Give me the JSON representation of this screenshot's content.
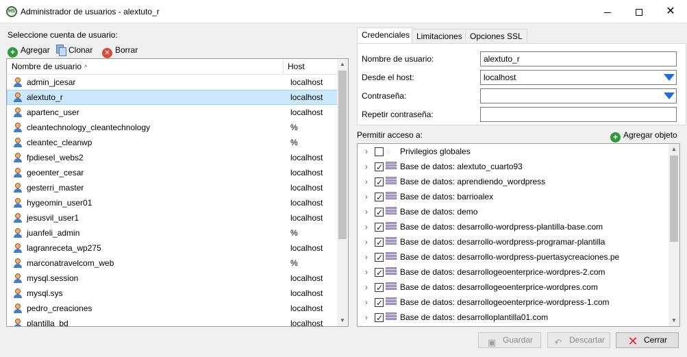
{
  "window": {
    "title": "Administrador de usuarios - alextuto_r",
    "app_icon": "HS"
  },
  "left": {
    "select_label": "Seleccione cuenta de usuario:",
    "toolbar": {
      "add": "Agregar",
      "clone": "Clonar",
      "delete": "Borrar"
    },
    "columns": {
      "name": "Nombre de usuario",
      "host": "Host"
    },
    "users": [
      {
        "name": "admin_jcesar",
        "host": "localhost"
      },
      {
        "name": "alextuto_r",
        "host": "localhost",
        "selected": true
      },
      {
        "name": "apartenc_user",
        "host": "localhost"
      },
      {
        "name": "cleantechnology_cleantechnology",
        "host": "%"
      },
      {
        "name": "cleantec_cleanwp",
        "host": "%"
      },
      {
        "name": "fpdiesel_webs2",
        "host": "localhost"
      },
      {
        "name": "geoenter_cesar",
        "host": "localhost"
      },
      {
        "name": "gesterri_master",
        "host": "localhost"
      },
      {
        "name": "hygeomin_user01",
        "host": "localhost"
      },
      {
        "name": "jesusvil_user1",
        "host": "localhost"
      },
      {
        "name": "juanfeli_admin",
        "host": "%"
      },
      {
        "name": "lagranreceta_wp275",
        "host": "localhost"
      },
      {
        "name": "marconatravelcom_web",
        "host": "%"
      },
      {
        "name": "mysql.session",
        "host": "localhost"
      },
      {
        "name": "mysql.sys",
        "host": "localhost"
      },
      {
        "name": "pedro_creaciones",
        "host": "localhost"
      },
      {
        "name": "plantilla_bd",
        "host": "localhost"
      }
    ]
  },
  "tabs": [
    {
      "label": "Credenciales",
      "active": true
    },
    {
      "label": "Limitaciones",
      "active": false
    },
    {
      "label": "Opciones SSL",
      "active": false
    }
  ],
  "credentials": {
    "username_label": "Nombre de usuario:",
    "username_value": "alextuto_r",
    "host_label": "Desde el host:",
    "host_value": "localhost",
    "password_label": "Contraseña:",
    "password_value": "",
    "repeat_label": "Repetir contraseña:",
    "repeat_value": ""
  },
  "access": {
    "label": "Permitir acceso a:",
    "add_object": "Agregar objeto",
    "items": [
      {
        "label": "Privilegios globales",
        "checked": false,
        "icon": "global-privileges-icon"
      },
      {
        "label": "Base de datos: alextuto_cuarto93",
        "checked": true,
        "icon": "database-icon"
      },
      {
        "label": "Base de datos: aprendiendo_wordpress",
        "checked": true,
        "icon": "database-icon"
      },
      {
        "label": "Base de datos: barrioalex",
        "checked": true,
        "icon": "database-icon"
      },
      {
        "label": "Base de datos: demo",
        "checked": true,
        "icon": "database-icon"
      },
      {
        "label": "Base de datos: desarrollo-wordpress-plantilla-base.com",
        "checked": true,
        "icon": "database-icon"
      },
      {
        "label": "Base de datos: desarrollo-wordpress-programar-plantilla",
        "checked": true,
        "icon": "database-icon"
      },
      {
        "label": "Base de datos: desarrollo-wordpress-puertasycreaciones.pe",
        "checked": true,
        "icon": "database-icon"
      },
      {
        "label": "Base de datos: desarrollogeoenterprice-wordpres-2.com",
        "checked": true,
        "icon": "database-icon"
      },
      {
        "label": "Base de datos: desarrollogeoenterprice-wordpres.com",
        "checked": true,
        "icon": "database-icon"
      },
      {
        "label": "Base de datos: desarrollogeoenterprice-wordpress-1.com",
        "checked": true,
        "icon": "database-icon"
      },
      {
        "label": "Base de datos: desarrolloplantilla01.com",
        "checked": true,
        "icon": "database-icon"
      }
    ]
  },
  "footer": {
    "save": "Guardar",
    "discard": "Descartar",
    "close": "Cerrar"
  },
  "colors": {
    "selection": "#cce8ff",
    "accent": "#1e6fd9",
    "add_green": "#2f9a3d",
    "delete_red": "#d84a3a"
  }
}
